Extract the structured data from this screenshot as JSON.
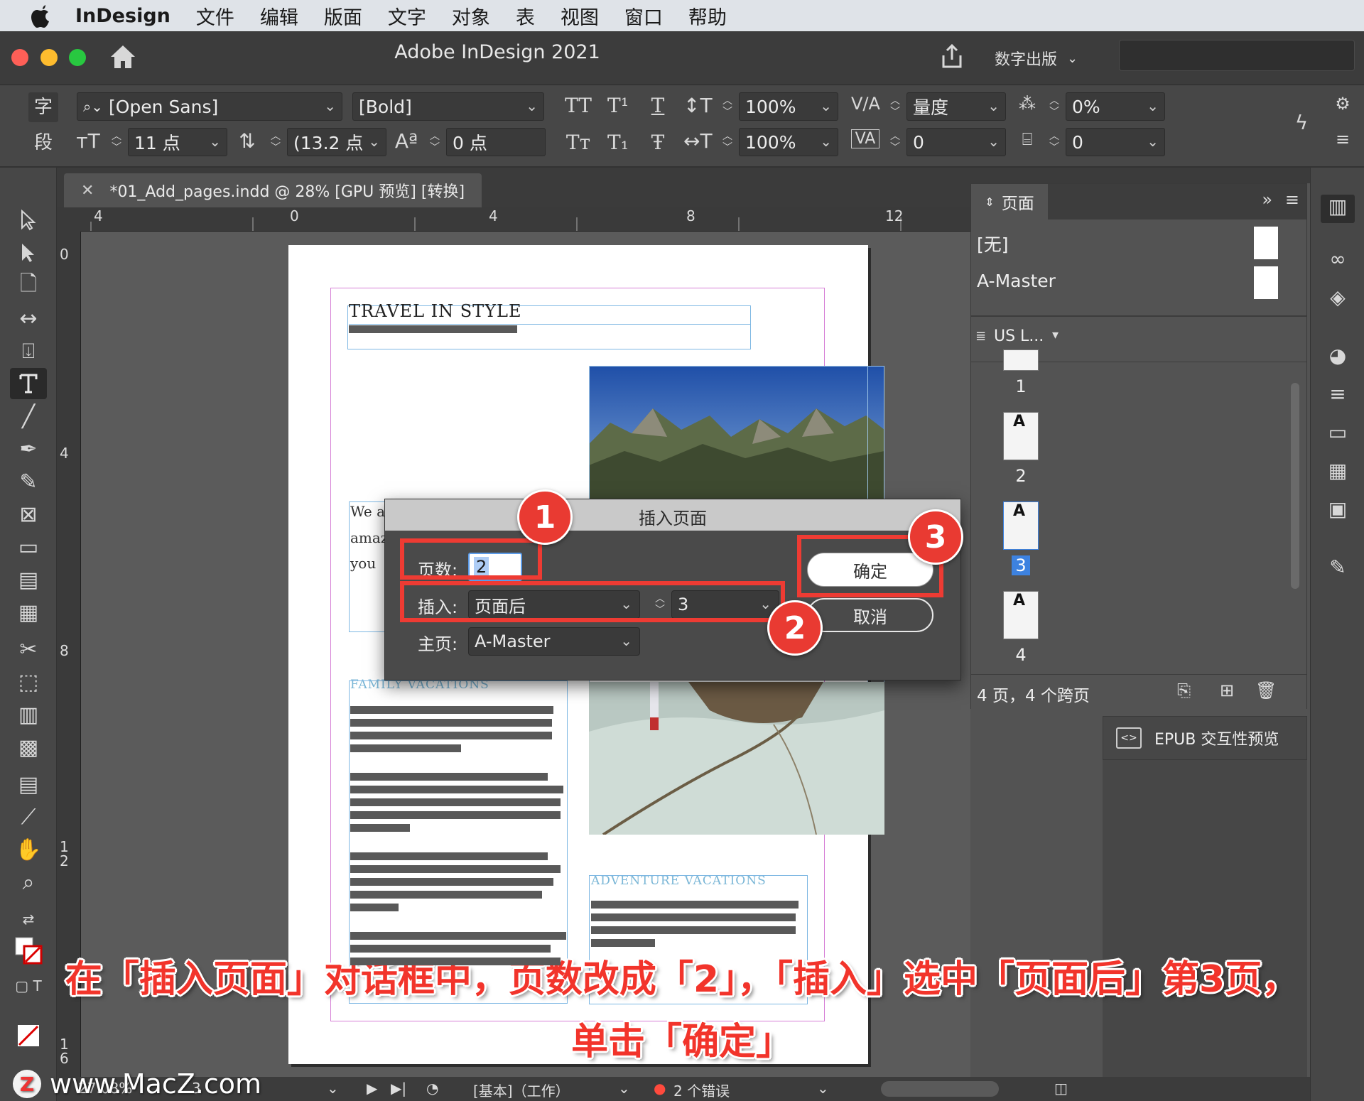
{
  "menubar": {
    "app_name": "InDesign",
    "items": [
      "文件",
      "编辑",
      "版面",
      "文字",
      "对象",
      "表",
      "视图",
      "窗口",
      "帮助"
    ]
  },
  "titlebar": {
    "title": "Adobe InDesign 2021",
    "workspace": "数字出版"
  },
  "control_panel": {
    "mode_char": "字",
    "mode_para": "段",
    "font_family": "[Open Sans]",
    "font_style": "[Bold]",
    "font_size": "11 点",
    "leading": "(13.2 点",
    "vertical_scale": "100%",
    "horizontal_scale": "100%",
    "kerning": "量度",
    "tracking": "0",
    "baseline_shift": "0 点",
    "tsume": "0%",
    "char_rotation": "0",
    "tt_allcaps": "TT",
    "tt_super": "T¹",
    "tt_underline": "T",
    "tt_smallcaps": "Tт",
    "tt_sub": "T₁",
    "tt_strike": "Ŧ"
  },
  "document": {
    "tab_label": "*01_Add_pages.indd @ 28% [GPU 预览] [转换]",
    "ruler_h": [
      "4",
      "0",
      "4",
      "8",
      "12"
    ],
    "ruler_v": [
      "0",
      "4",
      "8",
      "1\n2",
      "1\n6"
    ],
    "headline": "TRAVEL IN STYLE",
    "body_lines": [
      "We a",
      "amaz",
      "you"
    ],
    "section_family": "FAMILY VACATIONS",
    "section_adventure": "ADVENTURE VACATIONS"
  },
  "dialog": {
    "title": "插入页面",
    "pages_label": "页数:",
    "pages_value": "2",
    "insert_label": "插入:",
    "insert_position": "页面后",
    "insert_page": "3",
    "master_label": "主页:",
    "master_value": "A-Master",
    "ok_label": "确定",
    "cancel_label": "取消"
  },
  "badges": [
    "1",
    "2",
    "3"
  ],
  "pages_panel": {
    "tab_label": "页面",
    "masters": [
      "[无]",
      "A-Master"
    ],
    "page_size": "US L...",
    "pages": [
      "1",
      "2",
      "3",
      "4"
    ],
    "selected_page": "3",
    "status": "4 页，4 个跨页"
  },
  "epub_label": "EPUB 交互性预览",
  "statusbar": {
    "zoom": "27.08%",
    "page_field": "3",
    "style": "[基本]（工作）",
    "errors": "2 个错误"
  },
  "caption": {
    "line1": "在「插入页面」对话框中，页数改成「2」，「插入」选中「页面后」第3页，",
    "line2": "单击「确定」"
  },
  "watermark": "www.MacZ.com",
  "colors": {
    "annotation_red": "#ee3b33",
    "selection_blue": "#3d82e0"
  }
}
